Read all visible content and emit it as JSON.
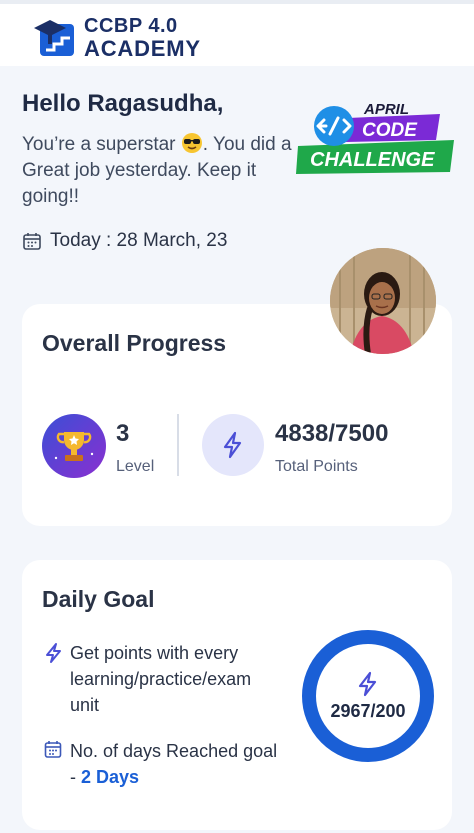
{
  "brand": {
    "line1": "CCBP 4.0",
    "line2": "ACADEMY",
    "color": "#1b2f66"
  },
  "greeting": {
    "hello": "Hello Ragasudha,",
    "message_part1": "You’re a superstar",
    "message_part2": ". You did a Great job yesterday. Keep it going!!",
    "emoji_icon": "sunglasses-emoji",
    "today": "Today : 28 March, 23"
  },
  "badge": {
    "top": "APRIL",
    "mid": "CODE",
    "bottom": "CHALLENGE"
  },
  "progress": {
    "title": "Overall Progress",
    "level_value": "3",
    "level_label": "Level",
    "points_value": "4838/7500",
    "points_label": "Total Points",
    "level_icon": "trophy-icon",
    "points_icon": "lightning-icon"
  },
  "daily_goal": {
    "title": "Daily Goal",
    "points_text": "Get points with every learning/practice/exam unit",
    "days_text": "No. of days Reached goal - ",
    "days_value": "2 Days",
    "ring_value": "2967/200",
    "accent": "#1a5fd6"
  }
}
